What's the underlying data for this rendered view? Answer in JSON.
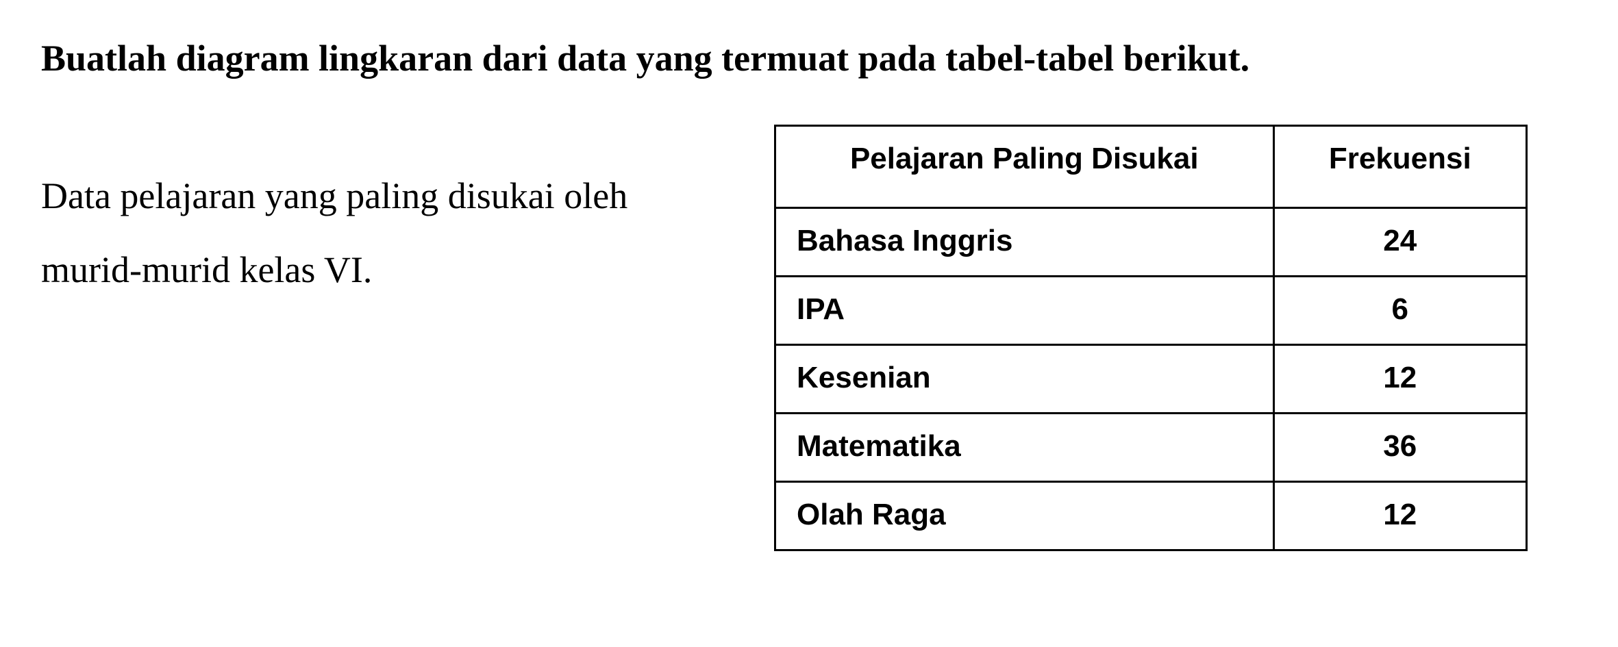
{
  "instruction": "Buatlah diagram lingkaran dari data yang termuat pada tabel-tabel berikut.",
  "description": "Data pelajaran yang paling disukai oleh murid-murid kelas VI.",
  "table": {
    "headers": {
      "col1": "Pelajaran Paling Disukai",
      "col2": "Frekuensi"
    },
    "rows": [
      {
        "subject": "Bahasa Inggris",
        "frequency": "24"
      },
      {
        "subject": "IPA",
        "frequency": "6"
      },
      {
        "subject": "Kesenian",
        "frequency": "12"
      },
      {
        "subject": "Matematika",
        "frequency": "36"
      },
      {
        "subject": "Olah Raga",
        "frequency": "12"
      }
    ]
  }
}
